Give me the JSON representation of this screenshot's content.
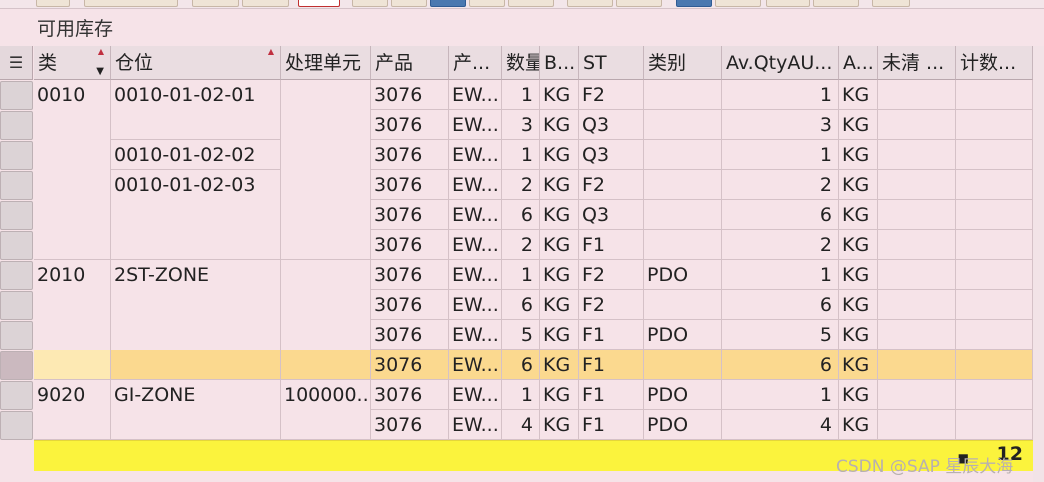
{
  "title": "可用库存",
  "columns": [
    "类",
    "仓位",
    "处理单元",
    "产品",
    "产...",
    "数量",
    "B...",
    "ST",
    "类别",
    "Av.QtyAU...",
    "A...",
    "未清 ...",
    "计数..."
  ],
  "rows": [
    {
      "type": "0010",
      "bin": "0010-01-02-01",
      "hu": "",
      "product": "3076",
      "prod_desc": "EW...",
      "qty": "1",
      "uom": "KG",
      "st": "F2",
      "cat": "",
      "avqty": "1",
      "auom": "KG"
    },
    {
      "type": "",
      "bin": "",
      "hu": "",
      "product": "3076",
      "prod_desc": "EW...",
      "qty": "3",
      "uom": "KG",
      "st": "Q3",
      "cat": "",
      "avqty": "3",
      "auom": "KG"
    },
    {
      "type": "",
      "bin": "0010-01-02-02",
      "hu": "",
      "product": "3076",
      "prod_desc": "EW...",
      "qty": "1",
      "uom": "KG",
      "st": "Q3",
      "cat": "",
      "avqty": "1",
      "auom": "KG"
    },
    {
      "type": "",
      "bin": "0010-01-02-03",
      "hu": "",
      "product": "3076",
      "prod_desc": "EW...",
      "qty": "2",
      "uom": "KG",
      "st": "F2",
      "cat": "",
      "avqty": "2",
      "auom": "KG"
    },
    {
      "type": "",
      "bin": "",
      "hu": "",
      "product": "3076",
      "prod_desc": "EW...",
      "qty": "6",
      "uom": "KG",
      "st": "Q3",
      "cat": "",
      "avqty": "6",
      "auom": "KG"
    },
    {
      "type": "",
      "bin": "",
      "hu": "",
      "product": "3076",
      "prod_desc": "EW...",
      "qty": "2",
      "uom": "KG",
      "st": "F1",
      "cat": "",
      "avqty": "2",
      "auom": "KG"
    },
    {
      "type": "2010",
      "bin": "2ST-ZONE",
      "hu": "",
      "product": "3076",
      "prod_desc": "EW...",
      "qty": "1",
      "uom": "KG",
      "st": "F2",
      "cat": "PDO",
      "avqty": "1",
      "auom": "KG"
    },
    {
      "type": "",
      "bin": "",
      "hu": "",
      "product": "3076",
      "prod_desc": "EW...",
      "qty": "6",
      "uom": "KG",
      "st": "F2",
      "cat": "",
      "avqty": "6",
      "auom": "KG"
    },
    {
      "type": "",
      "bin": "",
      "hu": "",
      "product": "3076",
      "prod_desc": "EW...",
      "qty": "5",
      "uom": "KG",
      "st": "F1",
      "cat": "PDO",
      "avqty": "5",
      "auom": "KG"
    },
    {
      "type": "",
      "bin": "",
      "hu": "",
      "product": "3076",
      "prod_desc": "EW...",
      "qty": "6",
      "uom": "KG",
      "st": "F1",
      "cat": "",
      "avqty": "6",
      "auom": "KG"
    },
    {
      "type": "9020",
      "bin": "GI-ZONE",
      "hu": "100000...",
      "product": "3076",
      "prod_desc": "EW...",
      "qty": "1",
      "uom": "KG",
      "st": "F1",
      "cat": "PDO",
      "avqty": "1",
      "auom": "KG"
    },
    {
      "type": "",
      "bin": "",
      "hu": "",
      "product": "3076",
      "prod_desc": "EW...",
      "qty": "4",
      "uom": "KG",
      "st": "F1",
      "cat": "PDO",
      "avqty": "4",
      "auom": "KG"
    }
  ],
  "selected_row": 9,
  "footer": {
    "count": "12"
  },
  "watermark": "CSDN @SAP 星辰大海",
  "colors": {
    "row_bg": "#f6e3e8",
    "selected_bg": "#fbd98f",
    "footer_bg": "#fbf33d"
  }
}
